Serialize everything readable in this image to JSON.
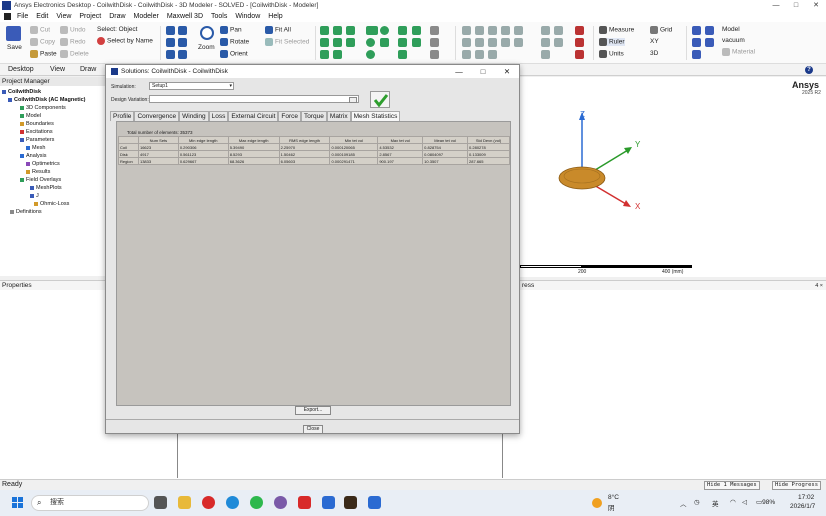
{
  "window": {
    "title": "Ansys Electronics Desktop - CoilwithDisk - CoilwithDisk - 3D Modeler - SOLVED - [CoilwithDisk - Modeler]",
    "min": "—",
    "max": "□",
    "close": "✕"
  },
  "menu": [
    "File",
    "Edit",
    "View",
    "Project",
    "Draw",
    "Modeler",
    "Maxwell 3D",
    "Tools",
    "Window",
    "Help"
  ],
  "ribbon": {
    "save": "Save",
    "cut": "Cut",
    "copy": "Copy",
    "paste": "Paste",
    "undo": "Undo",
    "redo": "Redo",
    "delete": "Delete",
    "select_object": "Select: Object",
    "select_by_name": "Select by Name",
    "zoom": "Zoom",
    "pan": "Pan",
    "rotate": "Rotate",
    "orient": "Orient",
    "fit_all": "Fit All",
    "fit_selected": "Fit Selected",
    "measure": "Measure",
    "ruler": "Ruler",
    "units": "Units",
    "grid": "Grid",
    "xy": "XY",
    "dim": "3D",
    "model": "Model",
    "vacuum": "vacuum",
    "material": "Material"
  },
  "tabs": [
    "Desktop",
    "View",
    "Draw"
  ],
  "project_manager": {
    "title": "Project Manager",
    "items": [
      "CoilwithDisk",
      "CoilwithDisk (AC Magnetic)",
      "3D Components",
      "Model",
      "Boundaries",
      "Excitations",
      "Parameters",
      "Mesh",
      "Analysis",
      "Optimetrics",
      "Results",
      "Field Overlays",
      "MeshPlots",
      "J",
      "Ohmic-Loss",
      "Definitions"
    ]
  },
  "modeler": {
    "logo": "Ansys",
    "version": "2025 R2",
    "axis_x": "X",
    "axis_y": "Y",
    "axis_z": "Z",
    "scale_mid": "200",
    "scale_end": "400 (mm)"
  },
  "panels": {
    "properties": "Properties",
    "progress": "ress",
    "progress_pin": "4 ×"
  },
  "status": {
    "ready": "Ready",
    "hide_messages": "Hide 1 Messages",
    "hide_progress": "Hide Progress"
  },
  "taskbar": {
    "search": "搜索",
    "weather_temp": "8°C",
    "weather_desc": "阴",
    "lang": "英",
    "battery": "98%",
    "time": "17:02",
    "date": "2026/1/7"
  },
  "dialog": {
    "title": "Solutions: CoilwithDisk - CoilwithDisk",
    "simulation_label": "Simulation:",
    "simulation_value": "Setup1",
    "design_variation_label": "Design Variation:",
    "tabs": [
      "Profile",
      "Convergence",
      "Winding",
      "Loss",
      "External Circuit",
      "Force",
      "Torque",
      "Matrix",
      "Mesh Statistics"
    ],
    "selected_tab": "Mesh Statistics",
    "total_elements": "Total number of elements: 35373",
    "columns": [
      "",
      "Num Sets",
      "Min edge length",
      "Max edge length",
      "RMS edge length",
      "Min tet vol",
      "Max tet vol",
      "Mean tet vol",
      "Std Devn (vol)"
    ],
    "rows": [
      [
        "Coil",
        "16623",
        "0.290306",
        "5.39490",
        "2.25970",
        "0.000120065",
        "4.53532",
        "0.828754",
        "0.280278"
      ],
      [
        "Disk",
        "4917",
        "0.561123",
        "8.5293",
        "1.50462",
        "0.000109185",
        "2.8567",
        "0.0804097",
        "0.133009"
      ],
      [
        "Region",
        "13833",
        "0.629667",
        "68.3626",
        "6.05603",
        "0.000291471",
        "900.197",
        "10.3507",
        "287.665"
      ]
    ],
    "export": "Export...",
    "close": "Close"
  },
  "colors": {
    "accent": "#1b3a8a",
    "check_green": "#2e9e2e",
    "disk": "#c98a2a",
    "axis_x": "#d23030",
    "axis_y": "#2a9a2a",
    "axis_z": "#2a6ad2"
  }
}
